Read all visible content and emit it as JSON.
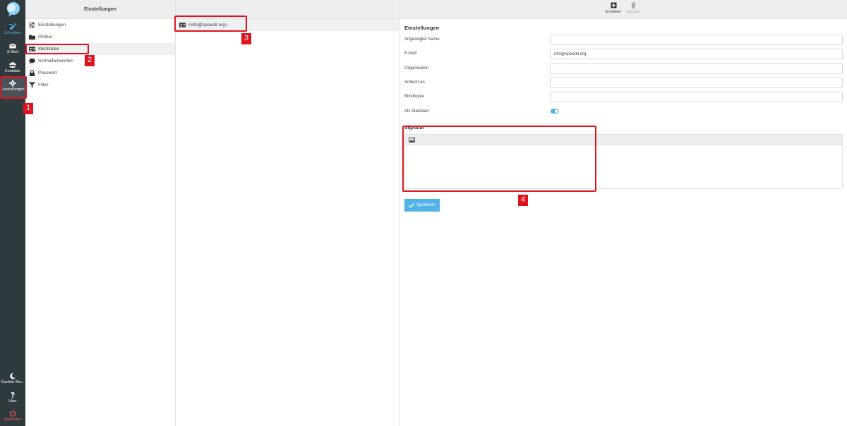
{
  "taskbar": {
    "items": [
      {
        "label": "Schreiben",
        "icon": "edit-icon"
      },
      {
        "label": "E-Mail",
        "icon": "mail-icon"
      },
      {
        "label": "Kontakte",
        "icon": "contacts-icon"
      },
      {
        "label": "Einstellungen",
        "icon": "gear-icon"
      }
    ],
    "bottom": [
      {
        "label": "Dunkler Mo...",
        "icon": "moon-icon"
      },
      {
        "label": "Über",
        "icon": "question-icon"
      },
      {
        "label": "Abmelden",
        "icon": "power-icon"
      }
    ]
  },
  "settings": {
    "title": "Einstellungen",
    "items": [
      {
        "label": "Einstellungen",
        "icon": "sliders-icon"
      },
      {
        "label": "Ordner",
        "icon": "folder-icon"
      },
      {
        "label": "Identitäten",
        "icon": "id-card-icon"
      },
      {
        "label": "Schnellantworten",
        "icon": "chat-icon"
      },
      {
        "label": "Passwort",
        "icon": "lock-icon"
      },
      {
        "label": "Filter",
        "icon": "filter-icon"
      }
    ]
  },
  "identities": {
    "items": [
      {
        "label": "<info@speedit.org>",
        "icon": "id-card-icon"
      }
    ]
  },
  "toolbar": {
    "create_label": "Erstellen",
    "delete_label": "Löschen"
  },
  "form": {
    "section_title": "Einstellungen",
    "display_name_label": "Angezeigter Name",
    "display_name_value": "",
    "email_label": "E-Mail",
    "email_value": "info@speedit.org",
    "organisation_label": "Organisation",
    "organisation_value": "",
    "reply_to_label": "Antwort an",
    "reply_to_value": "",
    "bcc_label": "Blindkopie",
    "bcc_value": "",
    "default_label": "Als Standard",
    "default_on": true,
    "signature_title": "Signatur",
    "save_label": "Speichern"
  },
  "annotations": [
    "1",
    "2",
    "3",
    "4"
  ],
  "colors": {
    "taskbar": "#2f3a3f",
    "accent": "#4fb3e8",
    "annotation": "#e0141e",
    "danger": "#e85a4f"
  }
}
